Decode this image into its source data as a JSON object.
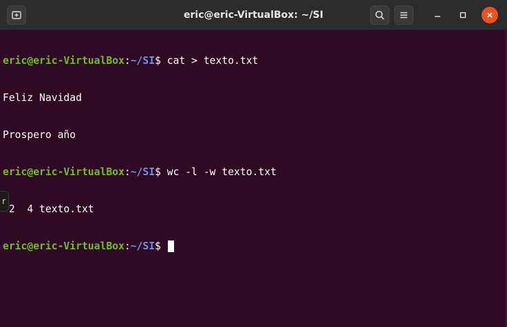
{
  "window": {
    "title": "eric@eric-VirtualBox: ~/SI"
  },
  "icons": {
    "new_tab": "new-tab-icon",
    "search": "search-icon",
    "menu": "hamburger-menu-icon",
    "minimize": "minimize-icon",
    "maximize": "maximize-icon",
    "close": "close-icon"
  },
  "colors": {
    "background": "#300a24",
    "prompt_user": "#6fbf2a",
    "prompt_path": "#6c96e4",
    "close_button": "#e95420"
  },
  "terminal": {
    "lines": [
      {
        "type": "prompt",
        "user_host": "eric@eric-VirtualBox",
        "sep": ":",
        "path": "~/SI",
        "dollar": "$ ",
        "command": "cat > texto.txt"
      },
      {
        "type": "output",
        "text": "Feliz Navidad"
      },
      {
        "type": "output",
        "text": "Prospero año"
      },
      {
        "type": "prompt",
        "user_host": "eric@eric-VirtualBox",
        "sep": ":",
        "path": "~/SI",
        "dollar": "$ ",
        "command": "wc -l -w texto.txt"
      },
      {
        "type": "output",
        "text": " 2  4 texto.txt"
      },
      {
        "type": "prompt",
        "user_host": "eric@eric-VirtualBox",
        "sep": ":",
        "path": "~/SI",
        "dollar": "$ ",
        "command": ""
      }
    ]
  },
  "side_tab": {
    "label": "r"
  }
}
